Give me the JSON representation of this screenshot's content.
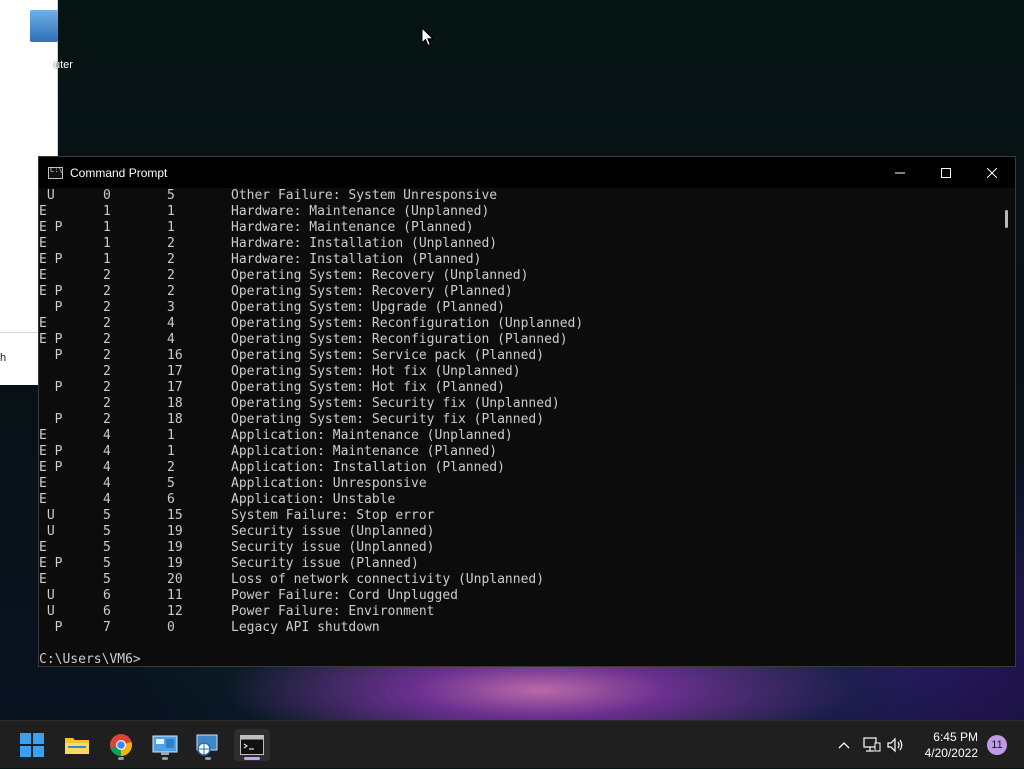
{
  "desktop": {
    "icon_label": "uter",
    "bg_window_snippet": "h"
  },
  "window": {
    "title": "Command Prompt",
    "icon": "cmd-icon",
    "controls": [
      "minimize-icon",
      "maximize-icon",
      "close-icon"
    ]
  },
  "console": {
    "rows": [
      {
        "flag": " U",
        "major": "0",
        "minor": "5",
        "desc": "Other Failure: System Unresponsive"
      },
      {
        "flag": "E",
        "major": "1",
        "minor": "1",
        "desc": "Hardware: Maintenance (Unplanned)"
      },
      {
        "flag": "E P",
        "major": "1",
        "minor": "1",
        "desc": "Hardware: Maintenance (Planned)"
      },
      {
        "flag": "E",
        "major": "1",
        "minor": "2",
        "desc": "Hardware: Installation (Unplanned)"
      },
      {
        "flag": "E P",
        "major": "1",
        "minor": "2",
        "desc": "Hardware: Installation (Planned)"
      },
      {
        "flag": "E",
        "major": "2",
        "minor": "2",
        "desc": "Operating System: Recovery (Unplanned)"
      },
      {
        "flag": "E P",
        "major": "2",
        "minor": "2",
        "desc": "Operating System: Recovery (Planned)"
      },
      {
        "flag": "  P",
        "major": "2",
        "minor": "3",
        "desc": "Operating System: Upgrade (Planned)"
      },
      {
        "flag": "E",
        "major": "2",
        "minor": "4",
        "desc": "Operating System: Reconfiguration (Unplanned)"
      },
      {
        "flag": "E P",
        "major": "2",
        "minor": "4",
        "desc": "Operating System: Reconfiguration (Planned)"
      },
      {
        "flag": "  P",
        "major": "2",
        "minor": "16",
        "desc": "Operating System: Service pack (Planned)"
      },
      {
        "flag": "",
        "major": "2",
        "minor": "17",
        "desc": "Operating System: Hot fix (Unplanned)"
      },
      {
        "flag": "  P",
        "major": "2",
        "minor": "17",
        "desc": "Operating System: Hot fix (Planned)"
      },
      {
        "flag": "",
        "major": "2",
        "minor": "18",
        "desc": "Operating System: Security fix (Unplanned)"
      },
      {
        "flag": "  P",
        "major": "2",
        "minor": "18",
        "desc": "Operating System: Security fix (Planned)"
      },
      {
        "flag": "E",
        "major": "4",
        "minor": "1",
        "desc": "Application: Maintenance (Unplanned)"
      },
      {
        "flag": "E P",
        "major": "4",
        "minor": "1",
        "desc": "Application: Maintenance (Planned)"
      },
      {
        "flag": "E P",
        "major": "4",
        "minor": "2",
        "desc": "Application: Installation (Planned)"
      },
      {
        "flag": "E",
        "major": "4",
        "minor": "5",
        "desc": "Application: Unresponsive"
      },
      {
        "flag": "E",
        "major": "4",
        "minor": "6",
        "desc": "Application: Unstable"
      },
      {
        "flag": " U",
        "major": "5",
        "minor": "15",
        "desc": "System Failure: Stop error"
      },
      {
        "flag": " U",
        "major": "5",
        "minor": "19",
        "desc": "Security issue (Unplanned)"
      },
      {
        "flag": "E",
        "major": "5",
        "minor": "19",
        "desc": "Security issue (Unplanned)"
      },
      {
        "flag": "E P",
        "major": "5",
        "minor": "19",
        "desc": "Security issue (Planned)"
      },
      {
        "flag": "E",
        "major": "5",
        "minor": "20",
        "desc": "Loss of network connectivity (Unplanned)"
      },
      {
        "flag": " U",
        "major": "6",
        "minor": "11",
        "desc": "Power Failure: Cord Unplugged"
      },
      {
        "flag": " U",
        "major": "6",
        "minor": "12",
        "desc": "Power Failure: Environment"
      },
      {
        "flag": "  P",
        "major": "7",
        "minor": "0",
        "desc": "Legacy API shutdown"
      }
    ],
    "prompt": "C:\\Users\\VM6>"
  },
  "taskbar": {
    "apps": [
      {
        "name": "start-button",
        "icon": "windows-logo-icon"
      },
      {
        "name": "file-explorer",
        "icon": "folder-icon"
      },
      {
        "name": "chrome",
        "icon": "chrome-icon"
      },
      {
        "name": "control-panel",
        "icon": "control-panel-icon"
      },
      {
        "name": "network-tool",
        "icon": "network-globe-icon"
      },
      {
        "name": "command-prompt",
        "icon": "cmd-icon"
      }
    ],
    "tray": {
      "time": "6:45 PM",
      "date": "4/20/2022",
      "notification_count": "11"
    }
  },
  "colors": {
    "console_bg": "#0c0c0c",
    "console_fg": "#cccccc",
    "taskbar_bg": "#1f1f1f",
    "accent": "#c19ae6"
  }
}
